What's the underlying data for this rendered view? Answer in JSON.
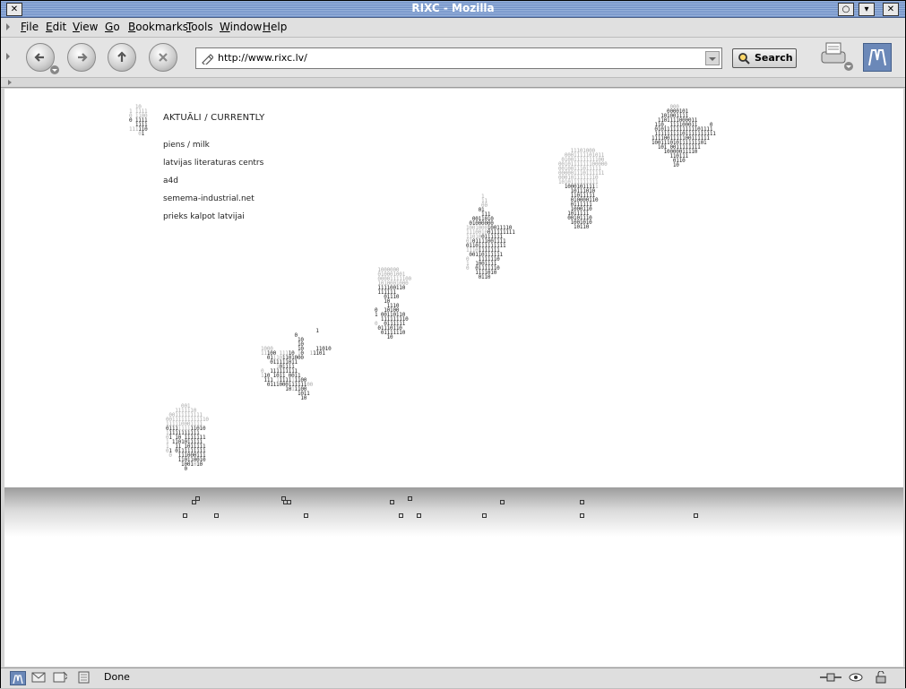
{
  "window": {
    "title": "RIXC - Mozilla"
  },
  "menubar": {
    "items": [
      {
        "label": "File",
        "hotkey": "F"
      },
      {
        "label": "Edit",
        "hotkey": "E"
      },
      {
        "label": "View",
        "hotkey": "V"
      },
      {
        "label": "Go",
        "hotkey": "G"
      },
      {
        "label": "Bookmarks",
        "hotkey": "B"
      },
      {
        "label": "Tools",
        "hotkey": "T"
      },
      {
        "label": "Window",
        "hotkey": "W"
      },
      {
        "label": "Help",
        "hotkey": "H"
      }
    ]
  },
  "toolbar": {
    "url": "http://www.rixc.lv/",
    "search_label": "Search"
  },
  "page": {
    "heading": "AKTUĀLI / CURRENTLY",
    "links": [
      "piens / milk",
      "latvijas literaturas centrs",
      "a4d",
      "semema-industrial.net",
      "prieks kalpot latvijai"
    ]
  },
  "status": {
    "text": "Done"
  },
  "colors": {
    "titlebar": "#7d9bcf",
    "chrome": "#e0e0e0"
  }
}
